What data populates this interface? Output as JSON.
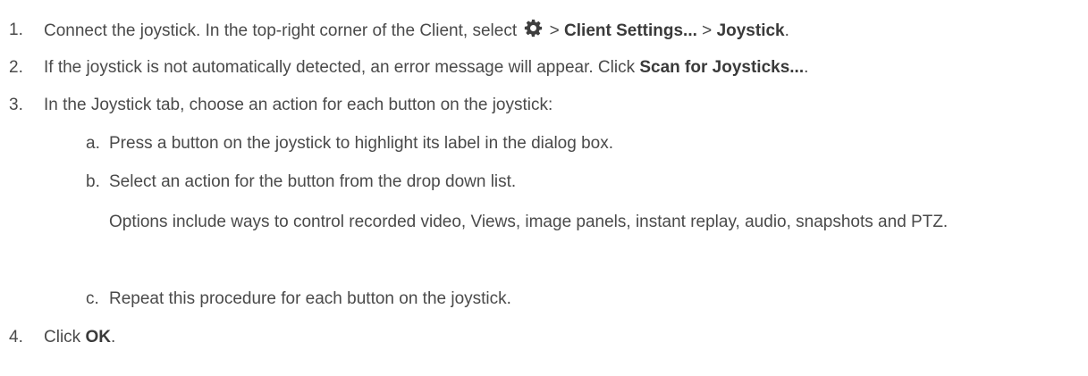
{
  "steps": [
    {
      "number": "1.",
      "text_a": "Connect the joystick. In the top-right corner of the Client, select",
      "icon": "gear-icon",
      "sep1": " > ",
      "bold1": "Client Settings...",
      "sep2": " > ",
      "bold2": "Joystick",
      "end": "."
    },
    {
      "number": "2.",
      "text_a": "If the joystick is not automatically detected, an error message will appear. Click ",
      "bold1": "Scan for Joysticks...",
      "end": "."
    },
    {
      "number": "3.",
      "text_a": "In the Joystick tab, choose an action for each button on the joystick:",
      "substeps": [
        {
          "letter": "a.",
          "text": "Press a button on the joystick to highlight its label in the dialog box."
        },
        {
          "letter": "b.",
          "text": "Select an action for the button from the drop down list.",
          "note": "Options include ways to control recorded video, Views, image panels, instant replay, audio, snapshots and PTZ."
        },
        {
          "letter": "c.",
          "text": "Repeat this procedure for each button on the joystick."
        }
      ]
    },
    {
      "number": "4.",
      "text_a": "Click ",
      "bold1": "OK",
      "end": "."
    }
  ]
}
